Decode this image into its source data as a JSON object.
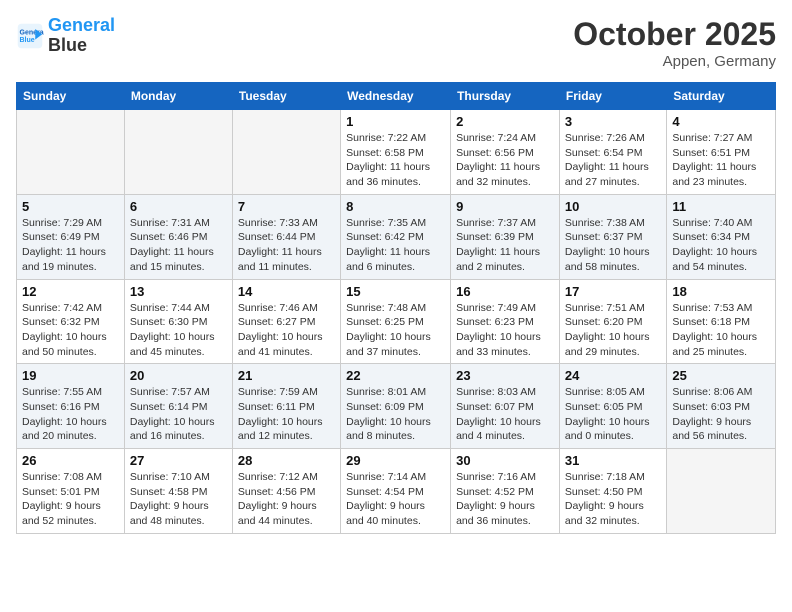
{
  "header": {
    "logo_line1": "General",
    "logo_line2": "Blue",
    "title": "October 2025",
    "subtitle": "Appen, Germany"
  },
  "columns": [
    "Sunday",
    "Monday",
    "Tuesday",
    "Wednesday",
    "Thursday",
    "Friday",
    "Saturday"
  ],
  "weeks": [
    [
      {
        "day": "",
        "info": ""
      },
      {
        "day": "",
        "info": ""
      },
      {
        "day": "",
        "info": ""
      },
      {
        "day": "1",
        "info": "Sunrise: 7:22 AM\nSunset: 6:58 PM\nDaylight: 11 hours\nand 36 minutes."
      },
      {
        "day": "2",
        "info": "Sunrise: 7:24 AM\nSunset: 6:56 PM\nDaylight: 11 hours\nand 32 minutes."
      },
      {
        "day": "3",
        "info": "Sunrise: 7:26 AM\nSunset: 6:54 PM\nDaylight: 11 hours\nand 27 minutes."
      },
      {
        "day": "4",
        "info": "Sunrise: 7:27 AM\nSunset: 6:51 PM\nDaylight: 11 hours\nand 23 minutes."
      }
    ],
    [
      {
        "day": "5",
        "info": "Sunrise: 7:29 AM\nSunset: 6:49 PM\nDaylight: 11 hours\nand 19 minutes."
      },
      {
        "day": "6",
        "info": "Sunrise: 7:31 AM\nSunset: 6:46 PM\nDaylight: 11 hours\nand 15 minutes."
      },
      {
        "day": "7",
        "info": "Sunrise: 7:33 AM\nSunset: 6:44 PM\nDaylight: 11 hours\nand 11 minutes."
      },
      {
        "day": "8",
        "info": "Sunrise: 7:35 AM\nSunset: 6:42 PM\nDaylight: 11 hours\nand 6 minutes."
      },
      {
        "day": "9",
        "info": "Sunrise: 7:37 AM\nSunset: 6:39 PM\nDaylight: 11 hours\nand 2 minutes."
      },
      {
        "day": "10",
        "info": "Sunrise: 7:38 AM\nSunset: 6:37 PM\nDaylight: 10 hours\nand 58 minutes."
      },
      {
        "day": "11",
        "info": "Sunrise: 7:40 AM\nSunset: 6:34 PM\nDaylight: 10 hours\nand 54 minutes."
      }
    ],
    [
      {
        "day": "12",
        "info": "Sunrise: 7:42 AM\nSunset: 6:32 PM\nDaylight: 10 hours\nand 50 minutes."
      },
      {
        "day": "13",
        "info": "Sunrise: 7:44 AM\nSunset: 6:30 PM\nDaylight: 10 hours\nand 45 minutes."
      },
      {
        "day": "14",
        "info": "Sunrise: 7:46 AM\nSunset: 6:27 PM\nDaylight: 10 hours\nand 41 minutes."
      },
      {
        "day": "15",
        "info": "Sunrise: 7:48 AM\nSunset: 6:25 PM\nDaylight: 10 hours\nand 37 minutes."
      },
      {
        "day": "16",
        "info": "Sunrise: 7:49 AM\nSunset: 6:23 PM\nDaylight: 10 hours\nand 33 minutes."
      },
      {
        "day": "17",
        "info": "Sunrise: 7:51 AM\nSunset: 6:20 PM\nDaylight: 10 hours\nand 29 minutes."
      },
      {
        "day": "18",
        "info": "Sunrise: 7:53 AM\nSunset: 6:18 PM\nDaylight: 10 hours\nand 25 minutes."
      }
    ],
    [
      {
        "day": "19",
        "info": "Sunrise: 7:55 AM\nSunset: 6:16 PM\nDaylight: 10 hours\nand 20 minutes."
      },
      {
        "day": "20",
        "info": "Sunrise: 7:57 AM\nSunset: 6:14 PM\nDaylight: 10 hours\nand 16 minutes."
      },
      {
        "day": "21",
        "info": "Sunrise: 7:59 AM\nSunset: 6:11 PM\nDaylight: 10 hours\nand 12 minutes."
      },
      {
        "day": "22",
        "info": "Sunrise: 8:01 AM\nSunset: 6:09 PM\nDaylight: 10 hours\nand 8 minutes."
      },
      {
        "day": "23",
        "info": "Sunrise: 8:03 AM\nSunset: 6:07 PM\nDaylight: 10 hours\nand 4 minutes."
      },
      {
        "day": "24",
        "info": "Sunrise: 8:05 AM\nSunset: 6:05 PM\nDaylight: 10 hours\nand 0 minutes."
      },
      {
        "day": "25",
        "info": "Sunrise: 8:06 AM\nSunset: 6:03 PM\nDaylight: 9 hours\nand 56 minutes."
      }
    ],
    [
      {
        "day": "26",
        "info": "Sunrise: 7:08 AM\nSunset: 5:01 PM\nDaylight: 9 hours\nand 52 minutes."
      },
      {
        "day": "27",
        "info": "Sunrise: 7:10 AM\nSunset: 4:58 PM\nDaylight: 9 hours\nand 48 minutes."
      },
      {
        "day": "28",
        "info": "Sunrise: 7:12 AM\nSunset: 4:56 PM\nDaylight: 9 hours\nand 44 minutes."
      },
      {
        "day": "29",
        "info": "Sunrise: 7:14 AM\nSunset: 4:54 PM\nDaylight: 9 hours\nand 40 minutes."
      },
      {
        "day": "30",
        "info": "Sunrise: 7:16 AM\nSunset: 4:52 PM\nDaylight: 9 hours\nand 36 minutes."
      },
      {
        "day": "31",
        "info": "Sunrise: 7:18 AM\nSunset: 4:50 PM\nDaylight: 9 hours\nand 32 minutes."
      },
      {
        "day": "",
        "info": ""
      }
    ]
  ]
}
